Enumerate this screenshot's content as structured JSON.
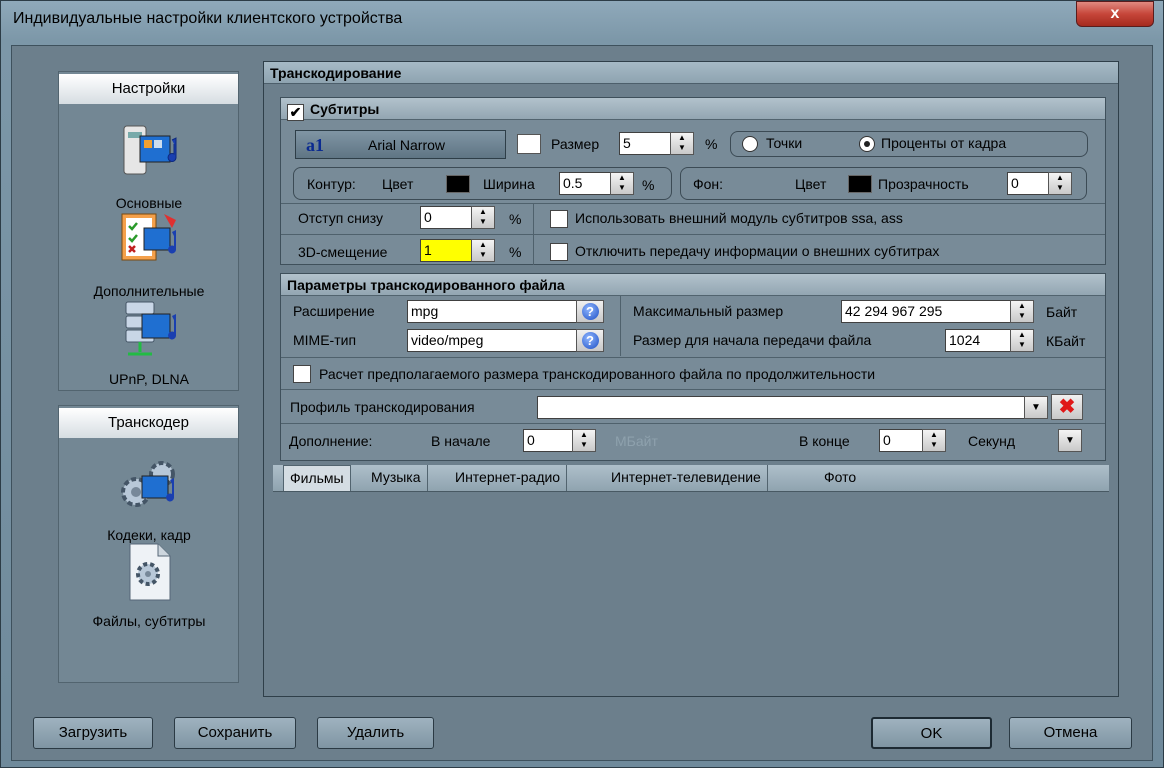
{
  "window": {
    "title": "Индивидуальные настройки клиентского устройства",
    "close_label": "x"
  },
  "sidebar": {
    "settings_header": "Настройки",
    "settings_items": [
      {
        "label": "Основные",
        "icon": "monitor-film-music-icon"
      },
      {
        "label": "Дополнительные",
        "icon": "checklist-film-icon"
      },
      {
        "label": "UPnP, DLNA",
        "icon": "server-film-icon"
      }
    ],
    "transcoder_header": "Транскодер",
    "transcoder_items": [
      {
        "label": "Кодеки, кадр",
        "icon": "gears-film-icon"
      },
      {
        "label": "Файлы, субтитры",
        "icon": "file-gear-icon"
      }
    ]
  },
  "main": {
    "header": "Транскодирование",
    "subtitles": {
      "enabled": true,
      "header": "Субтитры",
      "font_name": "Arial Narrow",
      "font_icon": "a1",
      "size_label": "Размер",
      "size_value": "5",
      "size_unit": "%",
      "radio_points": "Точки",
      "radio_percent": "Проценты от кадра",
      "radio_selected": "percent",
      "outline_label": "Контур:",
      "outline_color_label": "Цвет",
      "outline_width_label": "Ширина",
      "outline_width_value": "0.5",
      "outline_width_unit": "%",
      "bg_label": "Фон:",
      "bg_color_label": "Цвет",
      "bg_transparency_label": "Прозрачность",
      "bg_transparency_value": "0",
      "bottom_offset_label": "Отступ снизу",
      "bottom_offset_value": "0",
      "bottom_offset_unit": "%",
      "offset3d_label": "3D-смещение",
      "offset3d_value": "1",
      "offset3d_unit": "%",
      "use_external_module_label": "Использовать внешний модуль субтитров ssa, ass",
      "use_external_module_checked": false,
      "disable_external_info_label": "Отключить передачу информации о внешних субтитрах",
      "disable_external_info_checked": false
    },
    "file_params": {
      "header": "Параметры транскодированного файла",
      "extension_label": "Расширение",
      "extension_value": "mpg",
      "mime_label": "MIME-тип",
      "mime_value": "video/mpeg",
      "max_size_label": "Максимальный размер",
      "max_size_value": "42 294 967 295",
      "max_size_unit": "Байт",
      "start_size_label": "Размер для начала передачи файла",
      "start_size_value": "1024",
      "start_size_unit": "КБайт",
      "estimate_label": "Расчет предполагаемого размера транскодированного файла по продолжительности",
      "estimate_checked": false,
      "profile_label": "Профиль транскодирования",
      "profile_value": "",
      "padding_label": "Дополнение:",
      "at_start_label": "В начале",
      "at_start_value": "0",
      "at_start_unit": "МБайт",
      "at_end_label": "В конце",
      "at_end_value": "0",
      "at_end_unit": "Секунд"
    },
    "tabs": [
      "Фильмы",
      "Музыка",
      "Интернет-радио",
      "Интернет-телевидение",
      "Фото"
    ],
    "active_tab": "Фильмы"
  },
  "footer": {
    "load": "Загрузить",
    "save": "Сохранить",
    "delete": "Удалить",
    "ok": "OK",
    "cancel": "Отмена"
  },
  "colors": {
    "accent": "#6c7f8c",
    "highlight_input": "#ffff00",
    "close_red": "#c6463a"
  }
}
